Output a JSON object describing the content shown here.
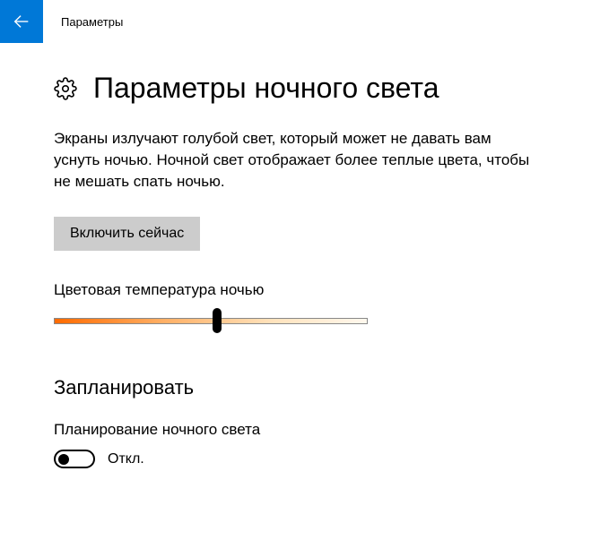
{
  "header": {
    "title": "Параметры"
  },
  "page": {
    "title": "Параметры ночного света",
    "description": "Экраны излучают голубой свет, который может не давать вам уснуть ночью. Ночной свет отображает более теплые цвета, чтобы не мешать спать ночью.",
    "enable_now_button": "Включить сейчас"
  },
  "temperature": {
    "label": "Цветовая температура ночью",
    "value_percent": 52
  },
  "schedule": {
    "heading": "Запланировать",
    "label": "Планирование ночного света",
    "toggle_state": "Откл.",
    "toggle_on": false
  },
  "colors": {
    "accent": "#0078d7",
    "button_bg": "#cccccc"
  }
}
